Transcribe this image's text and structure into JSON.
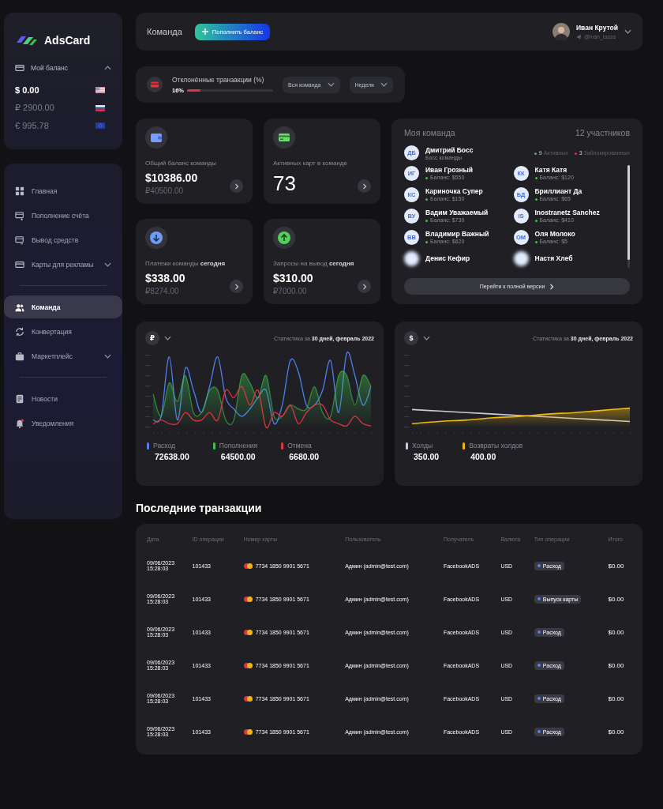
{
  "sidebar": {
    "logo": "AdsCard",
    "balance_title": "Мой баланс",
    "expanded": true,
    "balances": [
      {
        "amount": "$ 0.00",
        "kind": "us",
        "selected": true
      },
      {
        "amount": "₽ 2900.00",
        "kind": "ru",
        "selected": false
      },
      {
        "amount": "€ 995.78",
        "kind": "eu",
        "selected": false
      }
    ],
    "nav_groups": [
      [
        {
          "label": "Главная",
          "expandable": false,
          "selected": false
        },
        {
          "label": "Пополнение счёта",
          "expandable": false,
          "selected": false
        },
        {
          "label": "Вывод средств",
          "expandable": false,
          "selected": false
        },
        {
          "label": "Карты для рекламы",
          "expandable": true,
          "selected": false
        }
      ],
      [
        {
          "label": "Команда",
          "expandable": false,
          "selected": true
        },
        {
          "label": "Конвертация",
          "expandable": false,
          "selected": false
        },
        {
          "label": "Маркетплейс",
          "expandable": true,
          "selected": false
        }
      ],
      [
        {
          "label": "Новости",
          "expandable": false,
          "selected": false
        },
        {
          "label": "Уведомления",
          "expandable": false,
          "selected": false
        }
      ]
    ]
  },
  "header": {
    "title": "Команда",
    "button": "Пополнить баланс",
    "user": {
      "name": "Иван Крутой",
      "handle": "@ivan_tasss"
    }
  },
  "rejected": {
    "title": "Отклонённые транзакции (%)",
    "percent": "16%",
    "level": 0.16,
    "dropdowns": [
      "Вся команда",
      "Неделя"
    ]
  },
  "stat_cards": [
    {
      "kind": "wallet",
      "label": "Общий баланс команды",
      "value": "$10386.00",
      "sub": "₽40500.00"
    },
    {
      "kind": "card",
      "label": "Активных карт в команде",
      "value": "73"
    },
    {
      "kind": "down",
      "label": "Платежи команды **сегодня**",
      "value": "$338.00",
      "sub": "₽8274.00"
    },
    {
      "kind": "up",
      "label": "Запросы на вывод **сегодня**",
      "value": "$310.00",
      "sub": "₽7000.00"
    }
  ],
  "team": {
    "title": "Моя команда",
    "count": "12 участников",
    "boss": {
      "initials": "ДБ",
      "name": "Дмитрий Босс",
      "role": "Босс команды"
    },
    "active_count": "9",
    "active_label": "Активных",
    "blocked_count": "3",
    "blocked_label": "Заблокированных",
    "members": [
      {
        "initials": "ИГ",
        "name": "Иван Грозный",
        "balance": "Баланс: $550"
      },
      {
        "initials": "КК",
        "name": "Катя Катя",
        "balance": "Баланс: $120"
      },
      {
        "initials": "КС",
        "name": "Кариночка Супер",
        "balance": "Баланс: $150"
      },
      {
        "initials": "БД",
        "name": "Бриллиант Да",
        "balance": "Баланс: $65"
      },
      {
        "initials": "ВУ",
        "name": "Вадим Уважаемый",
        "balance": "Баланс: $730"
      },
      {
        "initials": "IS",
        "name": "Inostranetz Sanchez",
        "balance": "Баланс: $410"
      },
      {
        "initials": "ВВ",
        "name": "Владимир Важный",
        "balance": "Баланс: $620"
      },
      {
        "initials": "ОМ",
        "name": "Оля Молоко",
        "balance": "Баланс: $5"
      },
      {
        "name": "Денис Кефир"
      },
      {
        "name": "Настя Хлеб"
      }
    ],
    "button": "Перейти к полной версии"
  },
  "charts": [
    {
      "currency": "₽",
      "stat_label": "Статистика за",
      "period": "30 дней, февраль 2022",
      "legend": [
        {
          "label": "Расход",
          "value": "72638.00",
          "color": "#4f7ff0",
          "kind": "line"
        },
        {
          "label": "Пополнения",
          "value": "64500.00",
          "color": "#3fbf4f",
          "kind": "area"
        },
        {
          "label": "Отмена",
          "value": "6680.00",
          "color": "#e0343f",
          "kind": "line"
        }
      ]
    },
    {
      "currency": "$",
      "stat_label": "Статистика за",
      "period": "30 дней, февраль 2022",
      "legend": [
        {
          "label": "Холды",
          "value": "350.00",
          "color": "#c8ccd8",
          "kind": "line"
        },
        {
          "label": "Возвраты холдов",
          "value": "400.00",
          "color": "#f0b90b",
          "kind": "area"
        }
      ]
    }
  ],
  "transactions": {
    "title": "Последние транзакции",
    "columns": [
      "Дата",
      "ID операции",
      "Номер карты",
      "Пользователь",
      "Получатель",
      "Валюта",
      "Тип операции",
      "Итого"
    ],
    "rows": [
      {
        "date": "09/06/2023",
        "time": "15:28:03",
        "id": "101433",
        "card": "7734 1850 9901 5671",
        "user": "Админ (admin@test.com)",
        "recipient": "FacebookADS",
        "currency": "USD",
        "type": "Расход",
        "total": "$0.00"
      },
      {
        "date": "09/06/2023",
        "time": "15:28:03",
        "id": "101433",
        "card": "7734 1850 9901 5671",
        "user": "Админ (admin@test.com)",
        "recipient": "FacebookADS",
        "currency": "USD",
        "type": "Выпуск карты",
        "total": "$0.00"
      },
      {
        "date": "09/06/2023",
        "time": "15:28:03",
        "id": "101433",
        "card": "7734 1850 9901 5671",
        "user": "Админ (admin@test.com)",
        "recipient": "FacebookADS",
        "currency": "USD",
        "type": "Расход",
        "total": "$0.00"
      },
      {
        "date": "09/06/2023",
        "time": "15:28:03",
        "id": "101433",
        "card": "7734 1850 9901 5671",
        "user": "Админ (admin@test.com)",
        "recipient": "FacebookADS",
        "currency": "USD",
        "type": "Расход",
        "total": "$0.00"
      },
      {
        "date": "09/06/2023",
        "time": "15:28:03",
        "id": "101433",
        "card": "7734 1850 9901 5671",
        "user": "Админ (admin@test.com)",
        "recipient": "FacebookADS",
        "currency": "USD",
        "type": "Расход",
        "total": "$0.00"
      },
      {
        "date": "09/06/2023",
        "time": "15:28:03",
        "id": "101433",
        "card": "7734 1850 9901 5671",
        "user": "Админ (admin@test.com)",
        "recipient": "FacebookADS",
        "currency": "USD",
        "type": "Расход",
        "total": "$0.00"
      }
    ]
  }
}
